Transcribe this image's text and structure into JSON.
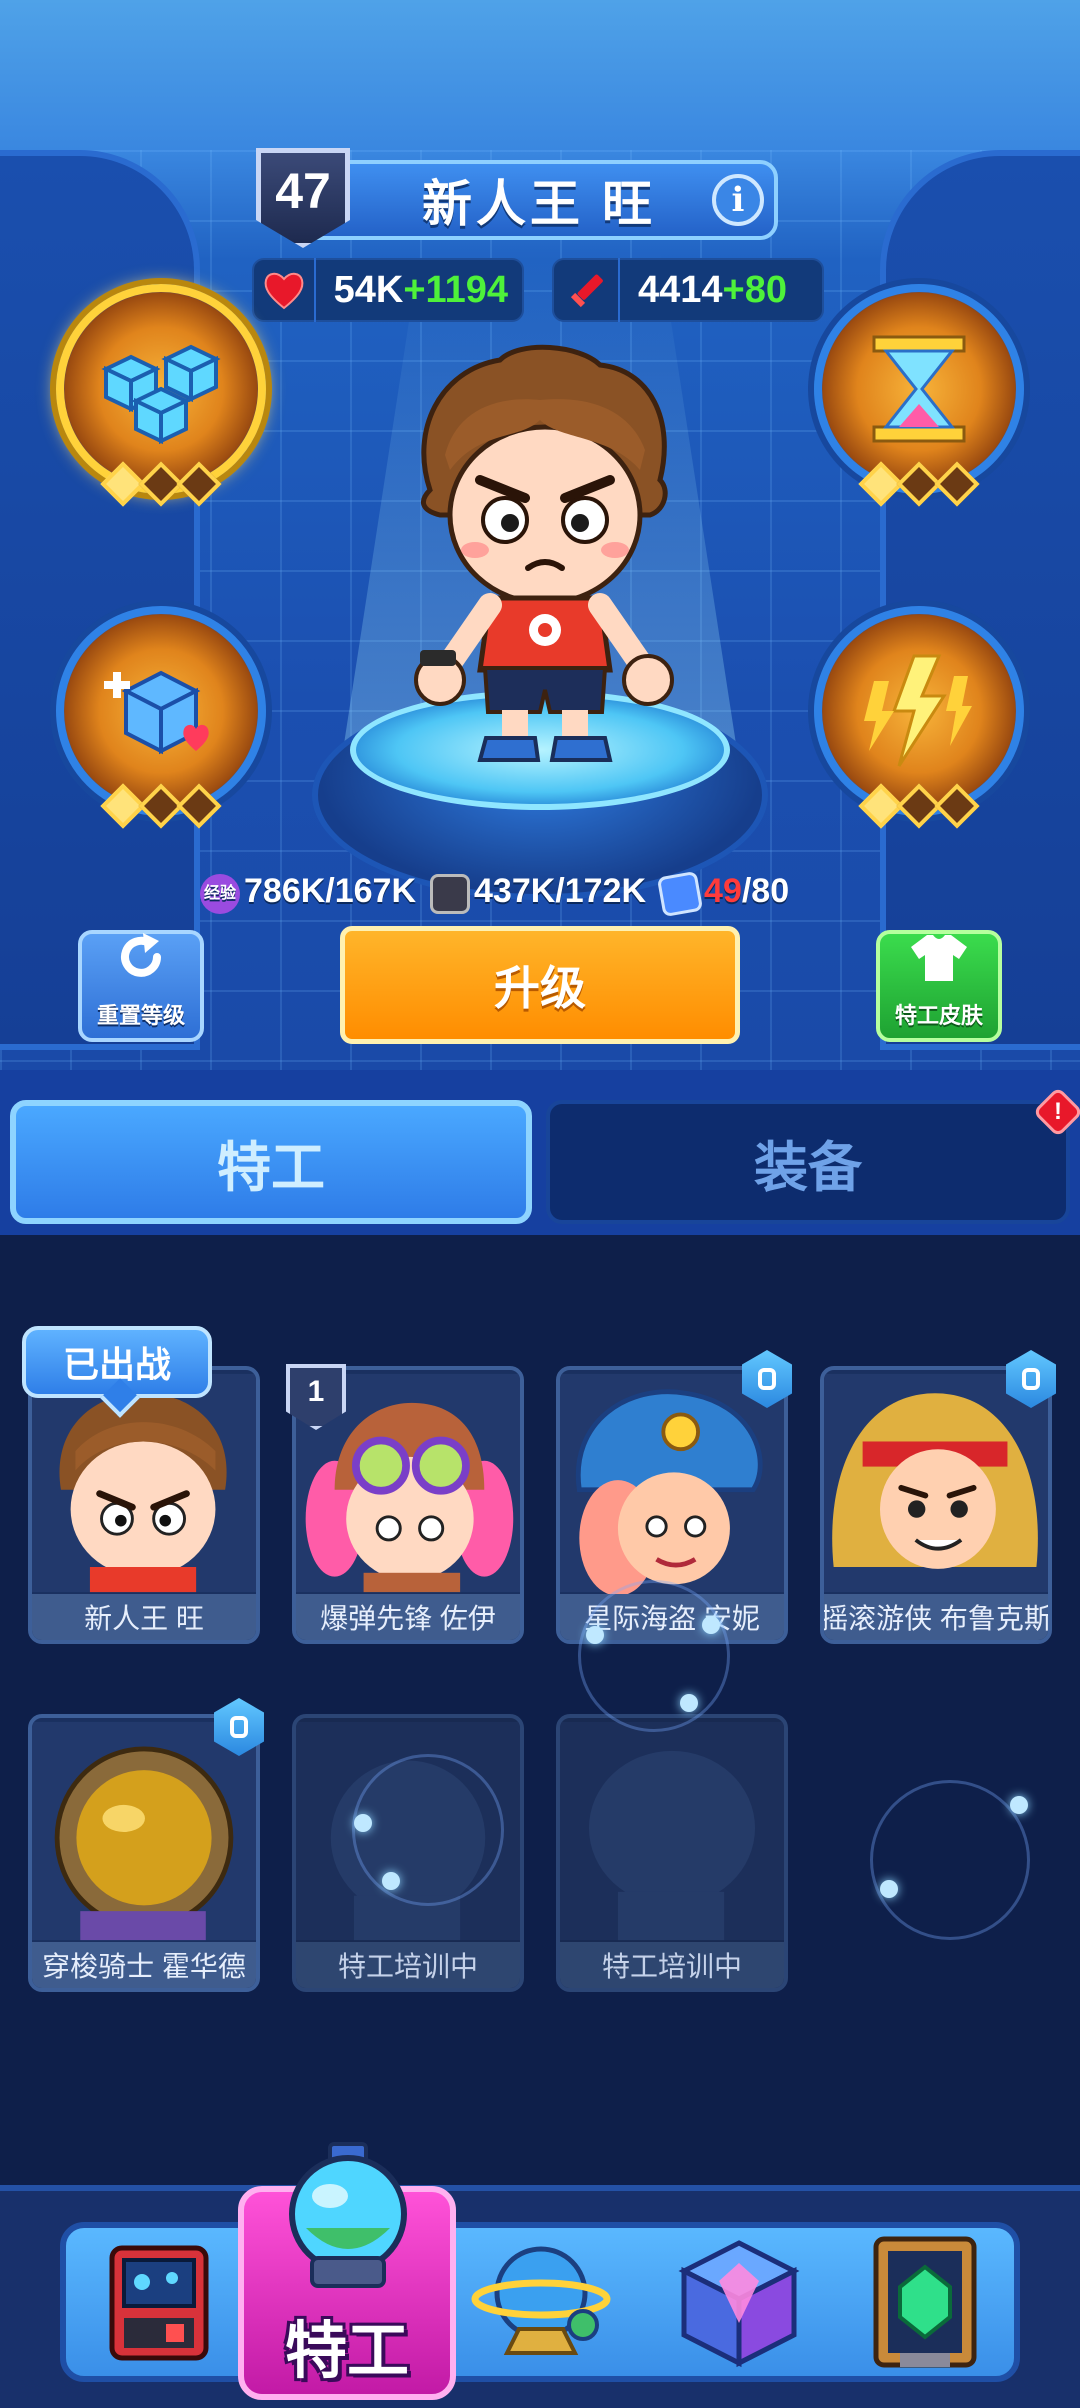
{
  "player": {
    "level": "47",
    "name": "新人王 旺",
    "info_icon": "info-icon",
    "hp_base": "54K",
    "hp_bonus": "+1194",
    "atk_base": "4414",
    "atk_bonus": "+80"
  },
  "resources": {
    "exp_icon_text": "经验",
    "exp": "786K/167K",
    "tape": "437K/172K",
    "card_current": "49",
    "card_total": "/80"
  },
  "actions": {
    "reset_label": "重置等级",
    "upgrade_label": "升级",
    "skin_label": "特工皮肤"
  },
  "tabs": [
    {
      "label": "特工",
      "active": true
    },
    {
      "label": "装备",
      "active": false,
      "alert": "!"
    }
  ],
  "deployed_label": "已出战",
  "agents": [
    {
      "name": "新人王 旺",
      "locked": false,
      "deployed": true
    },
    {
      "name": "爆弹先锋 佐伊",
      "locked": false,
      "level": "1"
    },
    {
      "name": "星际海盗 安妮",
      "locked": true
    },
    {
      "name": "摇滚游侠 布鲁克斯",
      "locked": true
    },
    {
      "name": "穿梭骑士 霍华德",
      "locked": true
    },
    {
      "name": "特工培训中",
      "locked": false,
      "training": true
    },
    {
      "name": "特工培训中",
      "locked": false,
      "training": true
    }
  ],
  "nav": {
    "active_label": "特工",
    "items": [
      "arcade-machine-icon",
      "agent-helmet-icon",
      "planet-icon",
      "crystal-cube-icon",
      "emerald-frame-icon"
    ]
  },
  "colors": {
    "bonus_green": "#4ef23a",
    "upgrade_orange": "#ff9a12",
    "skin_green": "#22b838",
    "nav_active_pink": "#e032c4",
    "alert_red": "#e8182a"
  }
}
